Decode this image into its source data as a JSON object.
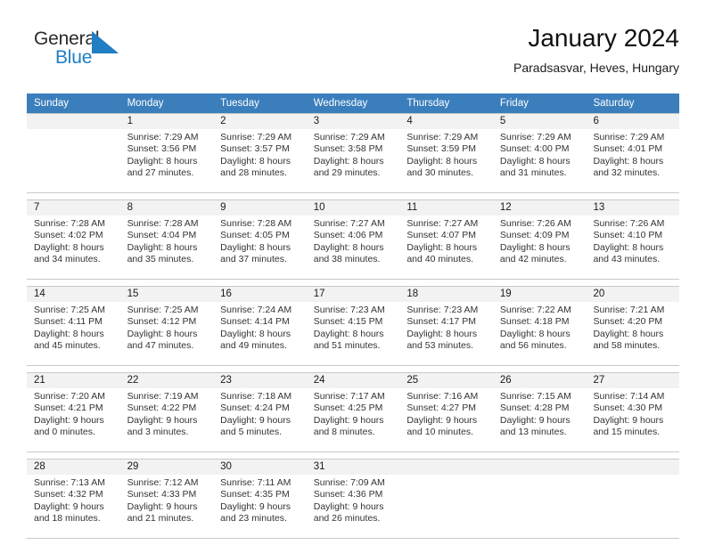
{
  "brand": {
    "name_part1": "General",
    "name_part2": "Blue",
    "flag_color": "#1f7ec4"
  },
  "header": {
    "title": "January 2024",
    "subtitle": "Paradsasvar, Heves, Hungary"
  },
  "theme": {
    "header_row_bg": "#3b7ebc",
    "daynum_bg": "#f2f2f2",
    "grid_line": "#c8c8c8"
  },
  "weekdays": [
    "Sunday",
    "Monday",
    "Tuesday",
    "Wednesday",
    "Thursday",
    "Friday",
    "Saturday"
  ],
  "weeks": [
    [
      {
        "day": "",
        "l1": "",
        "l2": "",
        "l3": "",
        "l4": ""
      },
      {
        "day": "1",
        "l1": "Sunrise: 7:29 AM",
        "l2": "Sunset: 3:56 PM",
        "l3": "Daylight: 8 hours",
        "l4": "and 27 minutes."
      },
      {
        "day": "2",
        "l1": "Sunrise: 7:29 AM",
        "l2": "Sunset: 3:57 PM",
        "l3": "Daylight: 8 hours",
        "l4": "and 28 minutes."
      },
      {
        "day": "3",
        "l1": "Sunrise: 7:29 AM",
        "l2": "Sunset: 3:58 PM",
        "l3": "Daylight: 8 hours",
        "l4": "and 29 minutes."
      },
      {
        "day": "4",
        "l1": "Sunrise: 7:29 AM",
        "l2": "Sunset: 3:59 PM",
        "l3": "Daylight: 8 hours",
        "l4": "and 30 minutes."
      },
      {
        "day": "5",
        "l1": "Sunrise: 7:29 AM",
        "l2": "Sunset: 4:00 PM",
        "l3": "Daylight: 8 hours",
        "l4": "and 31 minutes."
      },
      {
        "day": "6",
        "l1": "Sunrise: 7:29 AM",
        "l2": "Sunset: 4:01 PM",
        "l3": "Daylight: 8 hours",
        "l4": "and 32 minutes."
      }
    ],
    [
      {
        "day": "7",
        "l1": "Sunrise: 7:28 AM",
        "l2": "Sunset: 4:02 PM",
        "l3": "Daylight: 8 hours",
        "l4": "and 34 minutes."
      },
      {
        "day": "8",
        "l1": "Sunrise: 7:28 AM",
        "l2": "Sunset: 4:04 PM",
        "l3": "Daylight: 8 hours",
        "l4": "and 35 minutes."
      },
      {
        "day": "9",
        "l1": "Sunrise: 7:28 AM",
        "l2": "Sunset: 4:05 PM",
        "l3": "Daylight: 8 hours",
        "l4": "and 37 minutes."
      },
      {
        "day": "10",
        "l1": "Sunrise: 7:27 AM",
        "l2": "Sunset: 4:06 PM",
        "l3": "Daylight: 8 hours",
        "l4": "and 38 minutes."
      },
      {
        "day": "11",
        "l1": "Sunrise: 7:27 AM",
        "l2": "Sunset: 4:07 PM",
        "l3": "Daylight: 8 hours",
        "l4": "and 40 minutes."
      },
      {
        "day": "12",
        "l1": "Sunrise: 7:26 AM",
        "l2": "Sunset: 4:09 PM",
        "l3": "Daylight: 8 hours",
        "l4": "and 42 minutes."
      },
      {
        "day": "13",
        "l1": "Sunrise: 7:26 AM",
        "l2": "Sunset: 4:10 PM",
        "l3": "Daylight: 8 hours",
        "l4": "and 43 minutes."
      }
    ],
    [
      {
        "day": "14",
        "l1": "Sunrise: 7:25 AM",
        "l2": "Sunset: 4:11 PM",
        "l3": "Daylight: 8 hours",
        "l4": "and 45 minutes."
      },
      {
        "day": "15",
        "l1": "Sunrise: 7:25 AM",
        "l2": "Sunset: 4:12 PM",
        "l3": "Daylight: 8 hours",
        "l4": "and 47 minutes."
      },
      {
        "day": "16",
        "l1": "Sunrise: 7:24 AM",
        "l2": "Sunset: 4:14 PM",
        "l3": "Daylight: 8 hours",
        "l4": "and 49 minutes."
      },
      {
        "day": "17",
        "l1": "Sunrise: 7:23 AM",
        "l2": "Sunset: 4:15 PM",
        "l3": "Daylight: 8 hours",
        "l4": "and 51 minutes."
      },
      {
        "day": "18",
        "l1": "Sunrise: 7:23 AM",
        "l2": "Sunset: 4:17 PM",
        "l3": "Daylight: 8 hours",
        "l4": "and 53 minutes."
      },
      {
        "day": "19",
        "l1": "Sunrise: 7:22 AM",
        "l2": "Sunset: 4:18 PM",
        "l3": "Daylight: 8 hours",
        "l4": "and 56 minutes."
      },
      {
        "day": "20",
        "l1": "Sunrise: 7:21 AM",
        "l2": "Sunset: 4:20 PM",
        "l3": "Daylight: 8 hours",
        "l4": "and 58 minutes."
      }
    ],
    [
      {
        "day": "21",
        "l1": "Sunrise: 7:20 AM",
        "l2": "Sunset: 4:21 PM",
        "l3": "Daylight: 9 hours",
        "l4": "and 0 minutes."
      },
      {
        "day": "22",
        "l1": "Sunrise: 7:19 AM",
        "l2": "Sunset: 4:22 PM",
        "l3": "Daylight: 9 hours",
        "l4": "and 3 minutes."
      },
      {
        "day": "23",
        "l1": "Sunrise: 7:18 AM",
        "l2": "Sunset: 4:24 PM",
        "l3": "Daylight: 9 hours",
        "l4": "and 5 minutes."
      },
      {
        "day": "24",
        "l1": "Sunrise: 7:17 AM",
        "l2": "Sunset: 4:25 PM",
        "l3": "Daylight: 9 hours",
        "l4": "and 8 minutes."
      },
      {
        "day": "25",
        "l1": "Sunrise: 7:16 AM",
        "l2": "Sunset: 4:27 PM",
        "l3": "Daylight: 9 hours",
        "l4": "and 10 minutes."
      },
      {
        "day": "26",
        "l1": "Sunrise: 7:15 AM",
        "l2": "Sunset: 4:28 PM",
        "l3": "Daylight: 9 hours",
        "l4": "and 13 minutes."
      },
      {
        "day": "27",
        "l1": "Sunrise: 7:14 AM",
        "l2": "Sunset: 4:30 PM",
        "l3": "Daylight: 9 hours",
        "l4": "and 15 minutes."
      }
    ],
    [
      {
        "day": "28",
        "l1": "Sunrise: 7:13 AM",
        "l2": "Sunset: 4:32 PM",
        "l3": "Daylight: 9 hours",
        "l4": "and 18 minutes."
      },
      {
        "day": "29",
        "l1": "Sunrise: 7:12 AM",
        "l2": "Sunset: 4:33 PM",
        "l3": "Daylight: 9 hours",
        "l4": "and 21 minutes."
      },
      {
        "day": "30",
        "l1": "Sunrise: 7:11 AM",
        "l2": "Sunset: 4:35 PM",
        "l3": "Daylight: 9 hours",
        "l4": "and 23 minutes."
      },
      {
        "day": "31",
        "l1": "Sunrise: 7:09 AM",
        "l2": "Sunset: 4:36 PM",
        "l3": "Daylight: 9 hours",
        "l4": "and 26 minutes."
      },
      {
        "day": "",
        "l1": "",
        "l2": "",
        "l3": "",
        "l4": ""
      },
      {
        "day": "",
        "l1": "",
        "l2": "",
        "l3": "",
        "l4": ""
      },
      {
        "day": "",
        "l1": "",
        "l2": "",
        "l3": "",
        "l4": ""
      }
    ]
  ]
}
